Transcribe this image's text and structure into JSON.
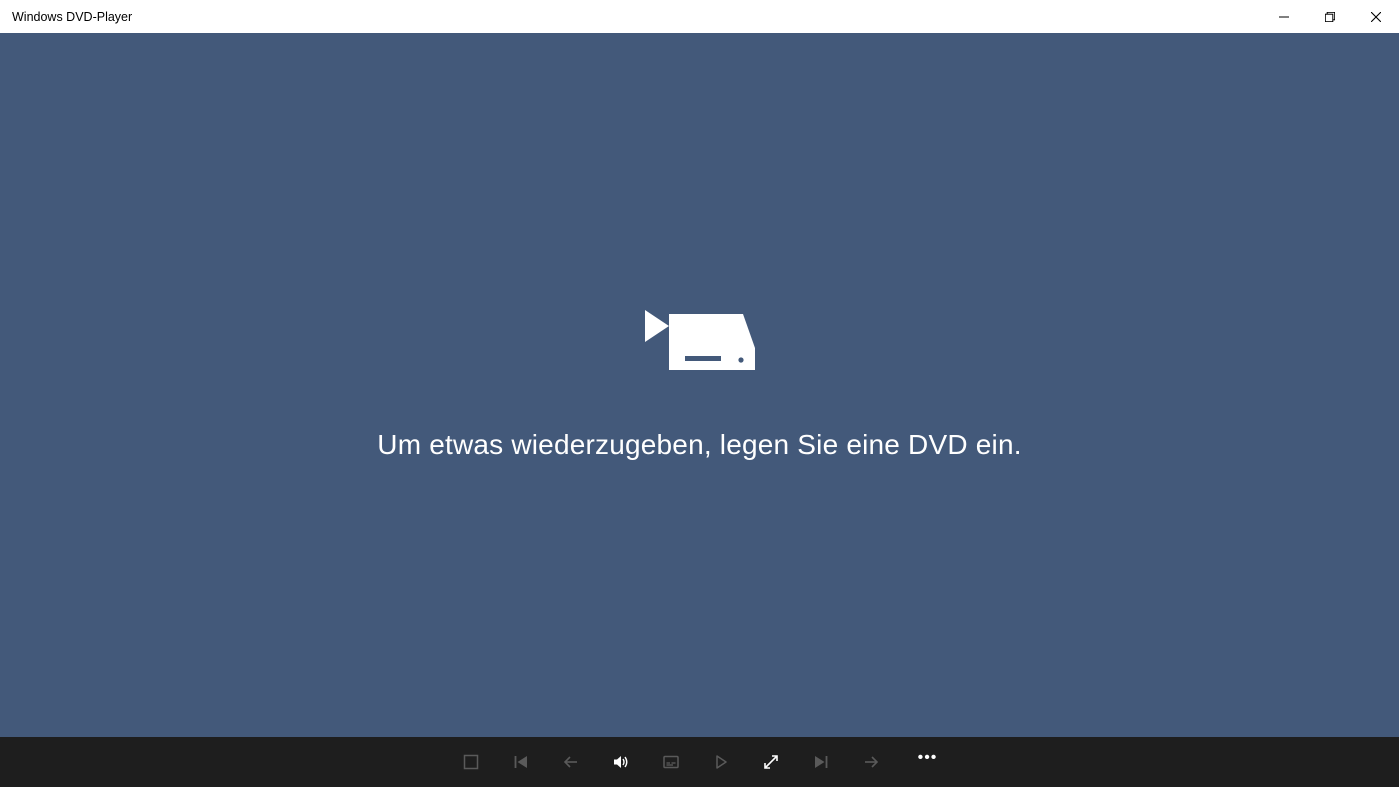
{
  "titlebar": {
    "title": "Windows DVD-Player"
  },
  "content": {
    "prompt": "Um etwas wiederzugeben, legen Sie eine DVD ein."
  },
  "playbar": {
    "more_label": "•••"
  }
}
